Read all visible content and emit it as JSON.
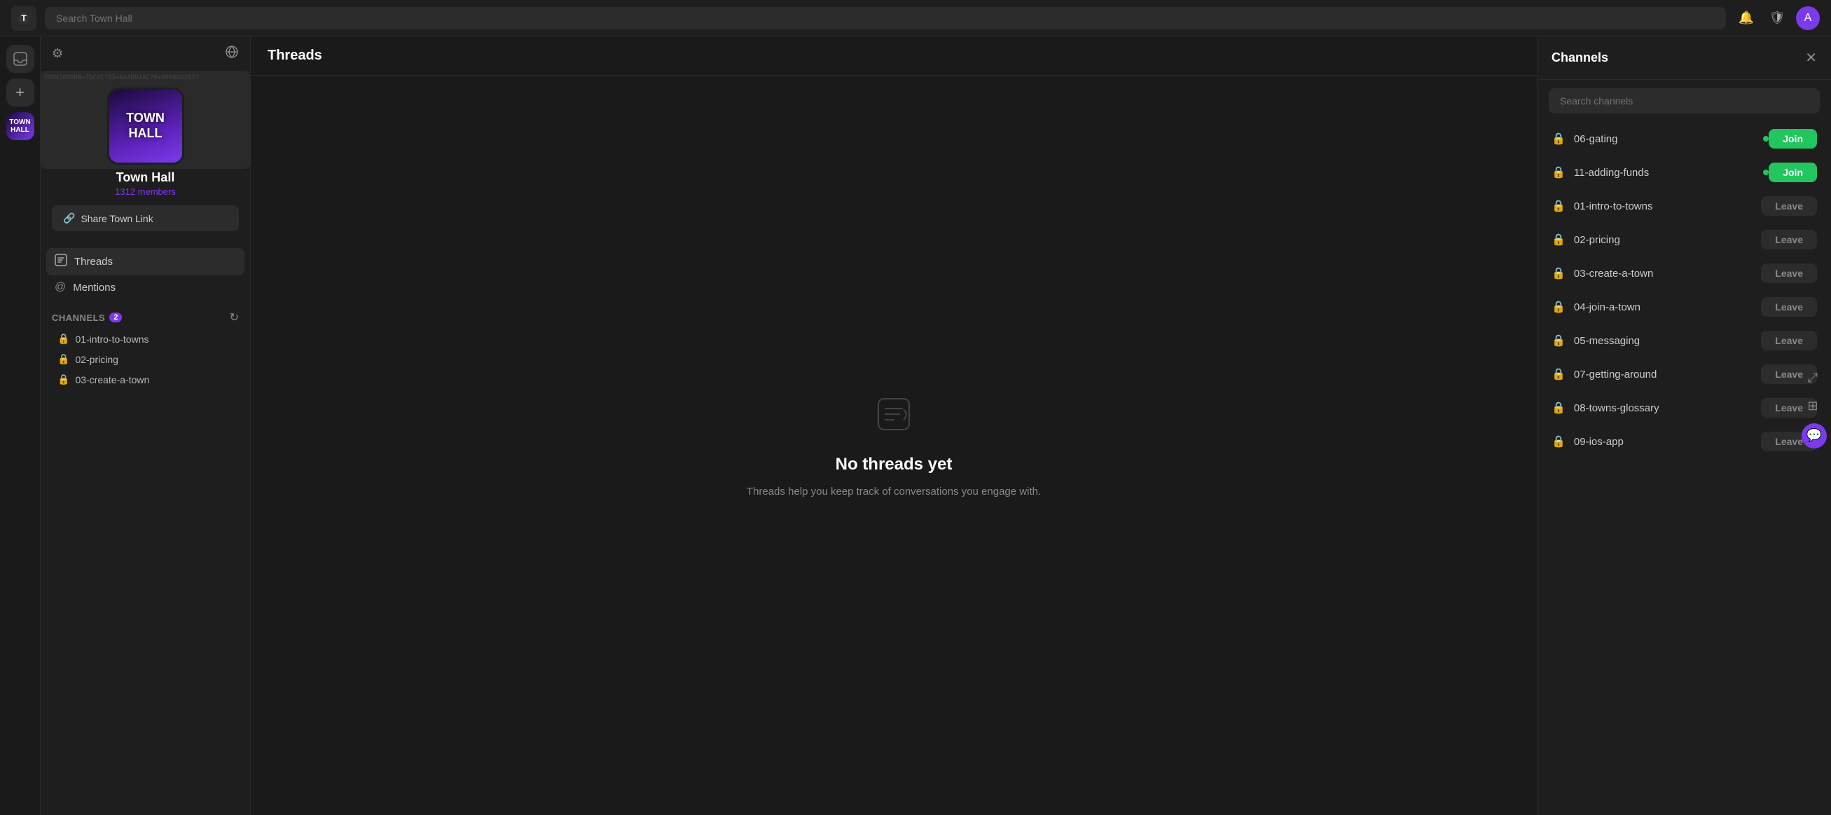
{
  "topbar": {
    "search_placeholder": "Search Town Hall",
    "logo_text": "T",
    "notification_icon": "🔔",
    "settings_icon": "🛡",
    "avatar_text": "A"
  },
  "sidebar": {
    "server_name": "Town Hall",
    "server_members": "1312 members",
    "share_link_label": "Share Town Link",
    "nav_items": [
      {
        "id": "threads",
        "label": "Threads",
        "icon": "⬜"
      },
      {
        "id": "mentions",
        "label": "Mentions",
        "icon": "@"
      }
    ],
    "channels_label": "Channels",
    "channels_badge": "2",
    "channels": [
      {
        "id": "01-intro-to-towns",
        "name": "01-intro-to-towns"
      },
      {
        "id": "02-pricing",
        "name": "02-pricing"
      },
      {
        "id": "03-create-a-town",
        "name": "03-create-a-town"
      }
    ]
  },
  "main": {
    "tab_label": "Threads",
    "no_threads_title": "No threads yet",
    "no_threads_subtitle": "Threads help you keep track of conversations you engage with."
  },
  "channels_panel": {
    "title": "Channels",
    "search_placeholder": "Search channels",
    "close_icon": "✕",
    "channels": [
      {
        "id": "06-gating",
        "name": "06-gating",
        "has_dot": true,
        "action": "Join",
        "action_type": "join"
      },
      {
        "id": "11-adding-funds",
        "name": "11-adding-funds",
        "has_dot": true,
        "action": "Join",
        "action_type": "join"
      },
      {
        "id": "01-intro-to-towns",
        "name": "01-intro-to-towns",
        "has_dot": false,
        "action": "Leave",
        "action_type": "leave"
      },
      {
        "id": "02-pricing",
        "name": "02-pricing",
        "has_dot": false,
        "action": "Leave",
        "action_type": "leave"
      },
      {
        "id": "03-create-a-town",
        "name": "03-create-a-town",
        "has_dot": false,
        "action": "Leave",
        "action_type": "leave"
      },
      {
        "id": "04-join-a-town",
        "name": "04-join-a-town",
        "has_dot": false,
        "action": "Leave",
        "action_type": "leave"
      },
      {
        "id": "05-messaging",
        "name": "05-messaging",
        "has_dot": false,
        "action": "Leave",
        "action_type": "leave"
      },
      {
        "id": "07-getting-around",
        "name": "07-getting-around",
        "has_dot": false,
        "action": "Leave",
        "action_type": "leave"
      },
      {
        "id": "08-towns-glossary",
        "name": "08-towns-glossary",
        "has_dot": false,
        "action": "Leave",
        "action_type": "leave"
      },
      {
        "id": "09-ios-app",
        "name": "09-ios-app",
        "has_dot": false,
        "action": "Leave",
        "action_type": "leave"
      }
    ]
  },
  "banner_code": "7D6936B6DB+7DC4C7D3+0AADD1AC70+D6B6D62B23",
  "colors": {
    "accent": "#7c3aed",
    "join_green": "#22c55e"
  }
}
